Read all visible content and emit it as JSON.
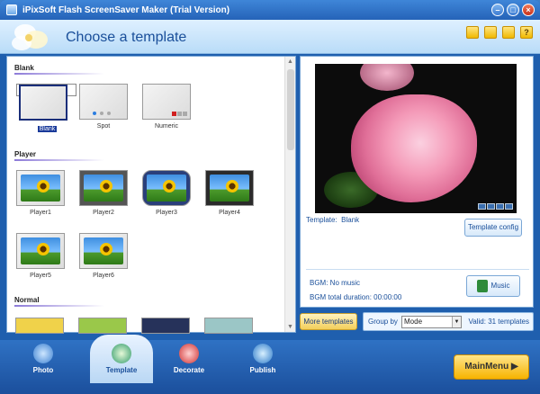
{
  "window": {
    "title": "iPixSoft Flash ScreenSaver Maker (Trial Version)",
    "min": "–",
    "max": "□",
    "close": "×"
  },
  "header": {
    "title": "Choose a template",
    "icons": [
      "folder-icon",
      "save-icon",
      "user-icon",
      "help-icon"
    ],
    "help_glyph": "?"
  },
  "sections": {
    "blank": {
      "title": "Blank",
      "items": [
        "Blank",
        "Spot",
        "Numeric"
      ]
    },
    "player": {
      "title": "Player",
      "items": [
        "Player1",
        "Player2",
        "Player3",
        "Player4",
        "Player5",
        "Player6"
      ]
    },
    "normal": {
      "title": "Normal"
    }
  },
  "preview": {
    "template_label": "Template:",
    "template_value": "Blank",
    "config_button": "Template config"
  },
  "bgm": {
    "text": "BGM: No music",
    "duration": "BGM total duration: 00:00:00",
    "music_button": "Music"
  },
  "bottom": {
    "more_templates": "More templates",
    "group_by": "Group by",
    "group_value": "Mode",
    "valid": "Valid: 31 templates"
  },
  "nav": {
    "items": [
      "Photo",
      "Template",
      "Decorate",
      "Publish"
    ],
    "active": "Template",
    "main_menu": "MainMenu ▶"
  },
  "colors": {
    "accent": "#1a4f9a",
    "nav": "#2f72c4",
    "gold": "#f6b300"
  }
}
